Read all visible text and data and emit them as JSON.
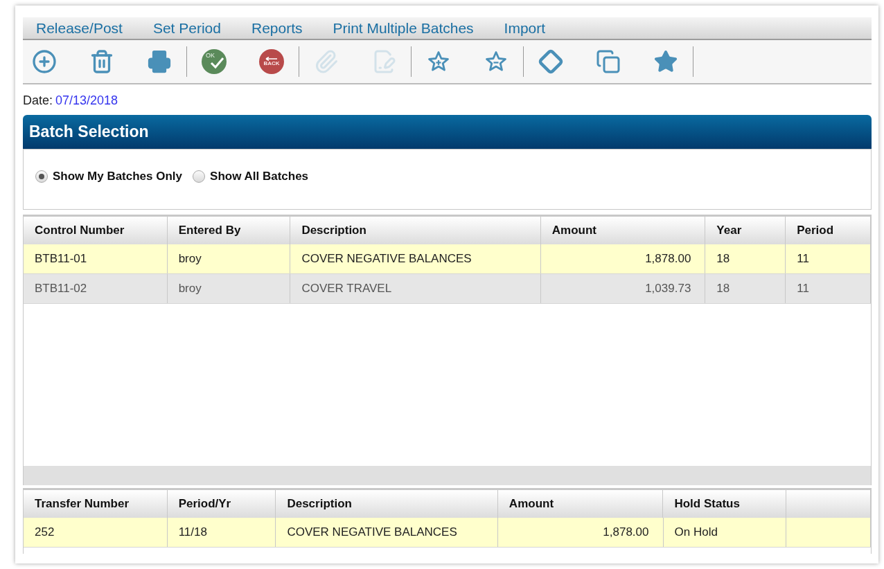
{
  "menu": [
    "Release/Post",
    "Set Period",
    "Reports",
    "Print Multiple Batches",
    "Import"
  ],
  "toolbar": [
    [
      {
        "kind": "add",
        "disabled": false
      },
      {
        "kind": "delete",
        "disabled": false
      },
      {
        "kind": "print",
        "disabled": false
      }
    ],
    [
      {
        "kind": "ok",
        "label": "OK",
        "disabled": false
      },
      {
        "kind": "back",
        "label": "BACK",
        "disabled": false
      }
    ],
    [
      {
        "kind": "attach",
        "disabled": true
      },
      {
        "kind": "edit",
        "disabled": true
      }
    ],
    [
      {
        "kind": "star-add",
        "disabled": false
      },
      {
        "kind": "star-remove",
        "disabled": false
      }
    ],
    [
      {
        "kind": "diamond",
        "disabled": false
      },
      {
        "kind": "copy",
        "disabled": false
      },
      {
        "kind": "star",
        "disabled": false
      }
    ]
  ],
  "date": {
    "label": "Date:",
    "value": "07/13/2018"
  },
  "panel": {
    "title": "Batch Selection",
    "filters": [
      {
        "label": "Show My Batches Only",
        "selected": true
      },
      {
        "label": "Show All Batches",
        "selected": false
      }
    ]
  },
  "batches": {
    "columns": [
      {
        "label": "Control Number",
        "kind": "text"
      },
      {
        "label": "Entered By",
        "kind": "text"
      },
      {
        "label": "Description",
        "kind": "text"
      },
      {
        "label": "Amount",
        "kind": "amount"
      },
      {
        "label": "Year",
        "kind": "text"
      },
      {
        "label": "Period",
        "kind": "text"
      }
    ],
    "rows": [
      {
        "selected": true,
        "cells": [
          "BTB11-01",
          "broy",
          "COVER NEGATIVE BALANCES",
          "1,878.00",
          "18",
          "11"
        ]
      },
      {
        "selected": false,
        "cells": [
          "BTB11-02",
          "broy",
          "COVER TRAVEL",
          "1,039.73",
          "18",
          "11"
        ]
      }
    ]
  },
  "transfers": {
    "columns": [
      {
        "label": "Transfer Number",
        "kind": "text"
      },
      {
        "label": "Period/Yr",
        "kind": "text"
      },
      {
        "label": "Description",
        "kind": "text"
      },
      {
        "label": "Amount",
        "kind": "amount"
      },
      {
        "label": "Hold Status",
        "kind": "text"
      },
      {
        "kind": "blank"
      }
    ],
    "rows": [
      {
        "selected": true,
        "cells": [
          "252",
          "11/18",
          "COVER NEGATIVE BALANCES",
          "1,878.00",
          "On Hold"
        ]
      }
    ]
  }
}
